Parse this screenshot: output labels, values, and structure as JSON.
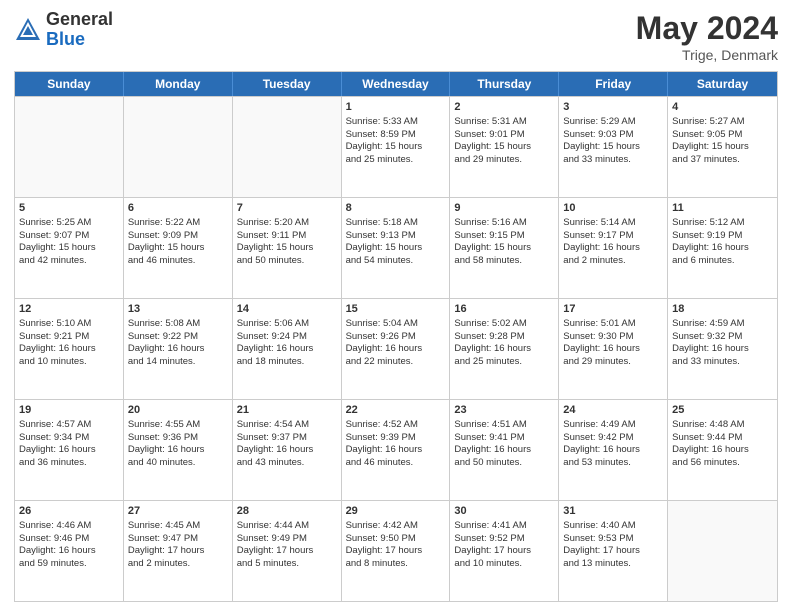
{
  "header": {
    "logo_general": "General",
    "logo_blue": "Blue",
    "title": "May 2024",
    "location": "Trige, Denmark"
  },
  "days_of_week": [
    "Sunday",
    "Monday",
    "Tuesday",
    "Wednesday",
    "Thursday",
    "Friday",
    "Saturday"
  ],
  "weeks": [
    [
      {
        "day": "",
        "info": ""
      },
      {
        "day": "",
        "info": ""
      },
      {
        "day": "",
        "info": ""
      },
      {
        "day": "1",
        "info": "Sunrise: 5:33 AM\nSunset: 8:59 PM\nDaylight: 15 hours\nand 25 minutes."
      },
      {
        "day": "2",
        "info": "Sunrise: 5:31 AM\nSunset: 9:01 PM\nDaylight: 15 hours\nand 29 minutes."
      },
      {
        "day": "3",
        "info": "Sunrise: 5:29 AM\nSunset: 9:03 PM\nDaylight: 15 hours\nand 33 minutes."
      },
      {
        "day": "4",
        "info": "Sunrise: 5:27 AM\nSunset: 9:05 PM\nDaylight: 15 hours\nand 37 minutes."
      }
    ],
    [
      {
        "day": "5",
        "info": "Sunrise: 5:25 AM\nSunset: 9:07 PM\nDaylight: 15 hours\nand 42 minutes."
      },
      {
        "day": "6",
        "info": "Sunrise: 5:22 AM\nSunset: 9:09 PM\nDaylight: 15 hours\nand 46 minutes."
      },
      {
        "day": "7",
        "info": "Sunrise: 5:20 AM\nSunset: 9:11 PM\nDaylight: 15 hours\nand 50 minutes."
      },
      {
        "day": "8",
        "info": "Sunrise: 5:18 AM\nSunset: 9:13 PM\nDaylight: 15 hours\nand 54 minutes."
      },
      {
        "day": "9",
        "info": "Sunrise: 5:16 AM\nSunset: 9:15 PM\nDaylight: 15 hours\nand 58 minutes."
      },
      {
        "day": "10",
        "info": "Sunrise: 5:14 AM\nSunset: 9:17 PM\nDaylight: 16 hours\nand 2 minutes."
      },
      {
        "day": "11",
        "info": "Sunrise: 5:12 AM\nSunset: 9:19 PM\nDaylight: 16 hours\nand 6 minutes."
      }
    ],
    [
      {
        "day": "12",
        "info": "Sunrise: 5:10 AM\nSunset: 9:21 PM\nDaylight: 16 hours\nand 10 minutes."
      },
      {
        "day": "13",
        "info": "Sunrise: 5:08 AM\nSunset: 9:22 PM\nDaylight: 16 hours\nand 14 minutes."
      },
      {
        "day": "14",
        "info": "Sunrise: 5:06 AM\nSunset: 9:24 PM\nDaylight: 16 hours\nand 18 minutes."
      },
      {
        "day": "15",
        "info": "Sunrise: 5:04 AM\nSunset: 9:26 PM\nDaylight: 16 hours\nand 22 minutes."
      },
      {
        "day": "16",
        "info": "Sunrise: 5:02 AM\nSunset: 9:28 PM\nDaylight: 16 hours\nand 25 minutes."
      },
      {
        "day": "17",
        "info": "Sunrise: 5:01 AM\nSunset: 9:30 PM\nDaylight: 16 hours\nand 29 minutes."
      },
      {
        "day": "18",
        "info": "Sunrise: 4:59 AM\nSunset: 9:32 PM\nDaylight: 16 hours\nand 33 minutes."
      }
    ],
    [
      {
        "day": "19",
        "info": "Sunrise: 4:57 AM\nSunset: 9:34 PM\nDaylight: 16 hours\nand 36 minutes."
      },
      {
        "day": "20",
        "info": "Sunrise: 4:55 AM\nSunset: 9:36 PM\nDaylight: 16 hours\nand 40 minutes."
      },
      {
        "day": "21",
        "info": "Sunrise: 4:54 AM\nSunset: 9:37 PM\nDaylight: 16 hours\nand 43 minutes."
      },
      {
        "day": "22",
        "info": "Sunrise: 4:52 AM\nSunset: 9:39 PM\nDaylight: 16 hours\nand 46 minutes."
      },
      {
        "day": "23",
        "info": "Sunrise: 4:51 AM\nSunset: 9:41 PM\nDaylight: 16 hours\nand 50 minutes."
      },
      {
        "day": "24",
        "info": "Sunrise: 4:49 AM\nSunset: 9:42 PM\nDaylight: 16 hours\nand 53 minutes."
      },
      {
        "day": "25",
        "info": "Sunrise: 4:48 AM\nSunset: 9:44 PM\nDaylight: 16 hours\nand 56 minutes."
      }
    ],
    [
      {
        "day": "26",
        "info": "Sunrise: 4:46 AM\nSunset: 9:46 PM\nDaylight: 16 hours\nand 59 minutes."
      },
      {
        "day": "27",
        "info": "Sunrise: 4:45 AM\nSunset: 9:47 PM\nDaylight: 17 hours\nand 2 minutes."
      },
      {
        "day": "28",
        "info": "Sunrise: 4:44 AM\nSunset: 9:49 PM\nDaylight: 17 hours\nand 5 minutes."
      },
      {
        "day": "29",
        "info": "Sunrise: 4:42 AM\nSunset: 9:50 PM\nDaylight: 17 hours\nand 8 minutes."
      },
      {
        "day": "30",
        "info": "Sunrise: 4:41 AM\nSunset: 9:52 PM\nDaylight: 17 hours\nand 10 minutes."
      },
      {
        "day": "31",
        "info": "Sunrise: 4:40 AM\nSunset: 9:53 PM\nDaylight: 17 hours\nand 13 minutes."
      },
      {
        "day": "",
        "info": ""
      }
    ]
  ]
}
